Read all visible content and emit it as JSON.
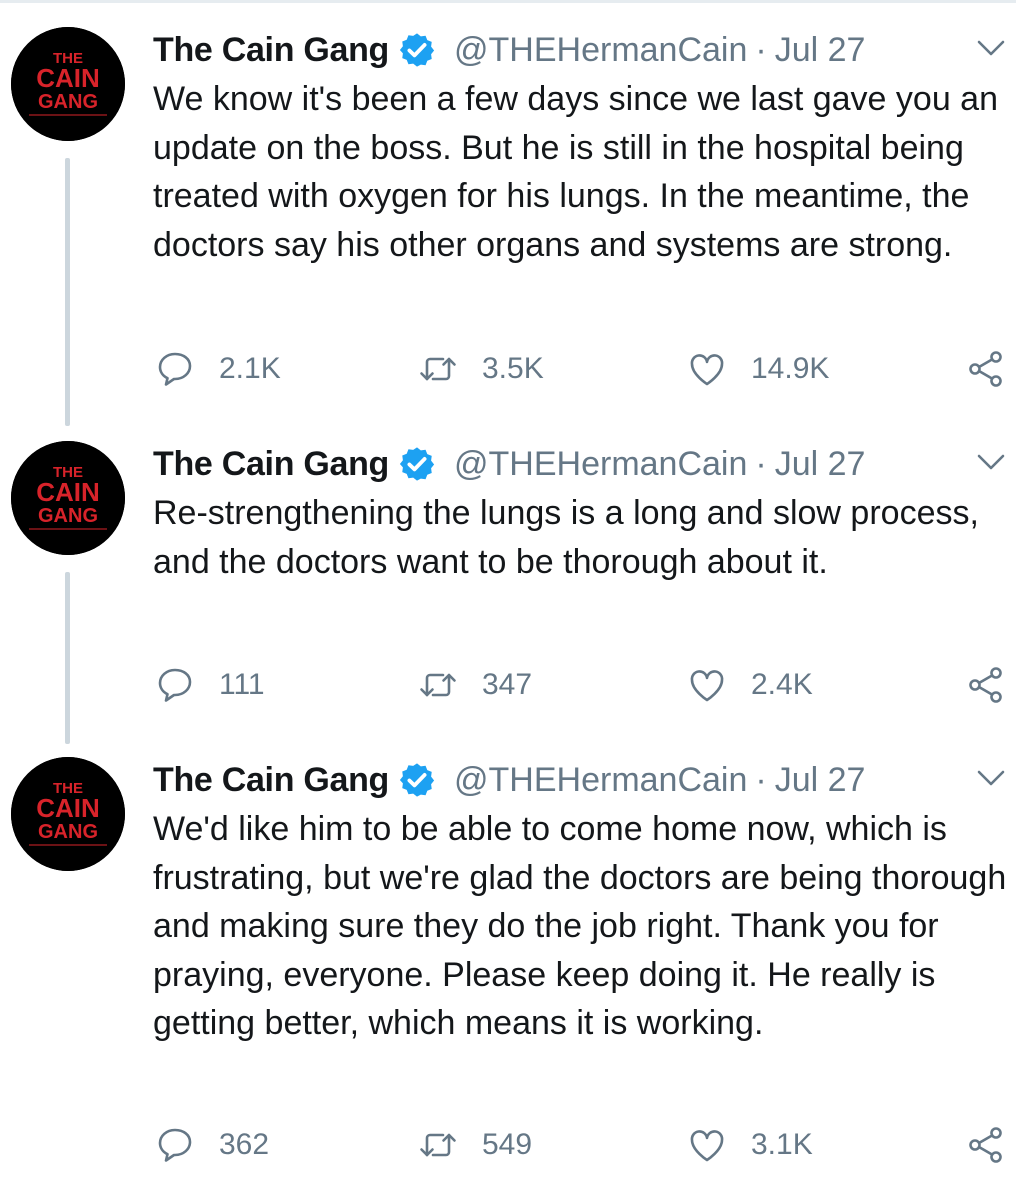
{
  "colors": {
    "text": "#14171a",
    "secondary": "#657786",
    "verified": "#1da1f2",
    "thread_line": "#ccd6dd",
    "avatar_bg": "#000000",
    "avatar_text": "#d8232a"
  },
  "avatar_text": {
    "line1": "THE",
    "line2": "CAIN",
    "line3": "GANG"
  },
  "tweets": [
    {
      "name": "The Cain Gang",
      "handle": "@THEHermanCain",
      "separator": "·",
      "date": "Jul 27",
      "text": "We know it's been a few days since we last gave you an update on the boss. But he is still in the hospital being treated with oxygen for his lungs. In the meantime, the doctors say his other organs and systems are strong.",
      "replies": "2.1K",
      "retweets": "3.5K",
      "likes": "14.9K"
    },
    {
      "name": "The Cain Gang",
      "handle": "@THEHermanCain",
      "separator": "·",
      "date": "Jul 27",
      "text": "Re-strengthening the lungs is a long and slow process, and the doctors want to be thorough about it.",
      "replies": "111",
      "retweets": "347",
      "likes": "2.4K"
    },
    {
      "name": "The Cain Gang",
      "handle": "@THEHermanCain",
      "separator": "·",
      "date": "Jul 27",
      "text": "We'd like him to be able to come home now, which is frustrating, but we're glad the doctors are being thorough and making sure they do the job right. Thank you for praying, everyone. Please keep doing it. He really is getting better, which means it is working.",
      "replies": "362",
      "retweets": "549",
      "likes": "3.1K"
    }
  ],
  "icons": {
    "avatar": "cain-gang-logo",
    "verified": "verified-badge-icon",
    "caret": "chevron-down-icon",
    "reply": "reply-icon",
    "retweet": "retweet-icon",
    "like": "heart-icon",
    "share": "share-icon"
  }
}
